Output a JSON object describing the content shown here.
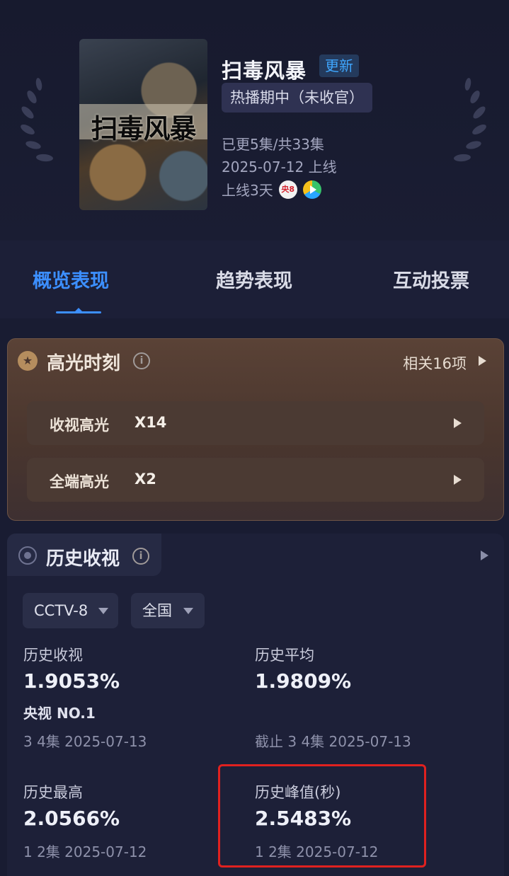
{
  "show": {
    "title": "扫毒风暴",
    "update_tag": "更新",
    "status": "热播期中（未收官）",
    "episodes": "已更5集/共33集",
    "premiere": "2025-07-12 上线",
    "days_online": "上线3天",
    "channel_badge": "央8",
    "poster_text": "扫毒风暴"
  },
  "tabs": [
    {
      "label": "概览表现",
      "active": true
    },
    {
      "label": "趋势表现",
      "active": false
    },
    {
      "label": "互动投票",
      "active": false
    }
  ],
  "highlights": {
    "title": "高光时刻",
    "info_glyph": "i",
    "related": "相关16项",
    "rows": [
      {
        "label": "收视高光",
        "count": "X14"
      },
      {
        "label": "全端高光",
        "count": "X2"
      }
    ]
  },
  "history": {
    "title": "历史收视",
    "info_glyph": "i",
    "channel_select": "CCTV-8",
    "region_select": "全国",
    "stats": {
      "rating": {
        "label": "历史收视",
        "value": "1.9053%",
        "rank": "央视 NO.1",
        "sub": "3 4集 2025-07-13"
      },
      "average": {
        "label": "历史平均",
        "value": "1.9809%",
        "sub": "截止 3 4集 2025-07-13"
      },
      "highest": {
        "label": "历史最高",
        "value": "2.0566%",
        "sub": "1 2集 2025-07-12"
      },
      "peak": {
        "label": "历史峰值(秒)",
        "value": "2.5483%",
        "sub": "1 2集 2025-07-12"
      }
    }
  },
  "colors": {
    "background": "#191c32",
    "accent_blue": "#3c8fff",
    "highlight_card": "#5a4236",
    "peak_box_border": "#e0211f"
  }
}
